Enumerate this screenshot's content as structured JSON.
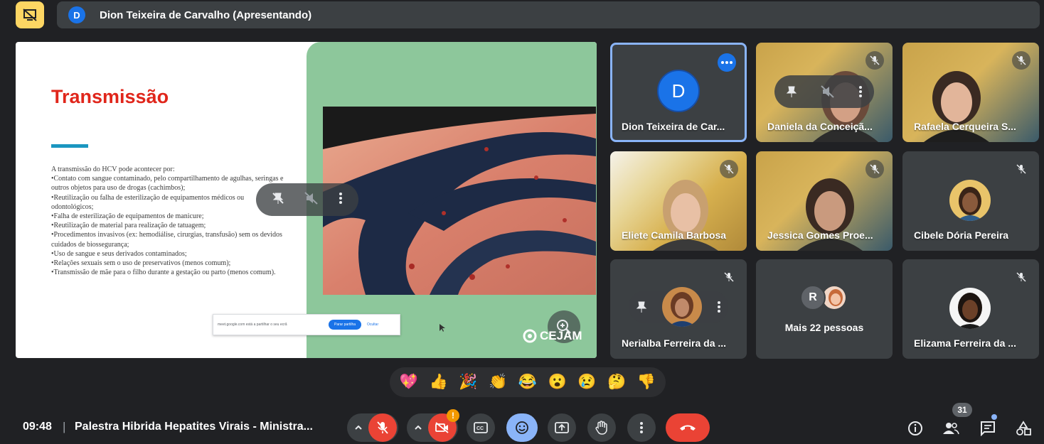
{
  "topbar": {
    "presenter_avatar_letter": "D",
    "presenter_text": "Dion Teixeira de Carvalho (Apresentando)"
  },
  "slide": {
    "title": "Transmissão",
    "body_lines": [
      "A transmissão do HCV pode acontecer por:",
      "•Contato com sangue contaminado, pelo compartilhamento de agulhas, seringas e outros objetos para uso de drogas (cachimbos);",
      "•Reutilização ou falha de esterilização de equipamentos médicos ou odontológicos;",
      "•Falha de esterilização de equipamentos de manicure;",
      "•Reutilização de material para realização de tatuagem;",
      "•Procedimentos invasivos (ex: hemodiálise, cirurgias, transfusão) sem os devidos cuidados de biossegurança;",
      "•Uso de sangue e seus derivados contaminados;",
      "•Relações sexuais sem o uso de preservativos (menos comum);",
      "•Transmissão de mãe para o filho durante a gestação ou parto (menos comum)."
    ],
    "share_notice": "meet.google.com está a partilhar o seu ecrã",
    "share_stop": "Parar partilha",
    "share_hide": "Ocultar",
    "logo": "CEJAM"
  },
  "tiles": [
    {
      "name": "Dion Teixeira de Car...",
      "avatar": "D"
    },
    {
      "name": "Daniela da Conceiçã..."
    },
    {
      "name": "Rafaela Cerqueira S..."
    },
    {
      "name": "Eliete Camila Barbosa"
    },
    {
      "name": "Jessica Gomes Proe..."
    },
    {
      "name": "Cibele Dória Pereira"
    },
    {
      "name": "Nerialba Ferreira da ..."
    },
    {
      "name": "Mais 22 pessoas",
      "avatar": "R"
    },
    {
      "name": "Elizama Ferreira da ..."
    }
  ],
  "reactions": [
    "💖",
    "👍",
    "🎉",
    "👏",
    "😂",
    "😮",
    "😢",
    "🤔",
    "👎"
  ],
  "bottombar": {
    "time": "09:48",
    "separator": "|",
    "meeting_title": "Palestra Hibrida Hepatites Virais - Ministra...",
    "camera_badge": "!",
    "participants_count": "31"
  },
  "colors": {
    "background": "#202124",
    "tile": "#3c4043",
    "accent_blue": "#8ab4f8",
    "danger_red": "#ea4335",
    "present_yellow": "#fdd663"
  }
}
